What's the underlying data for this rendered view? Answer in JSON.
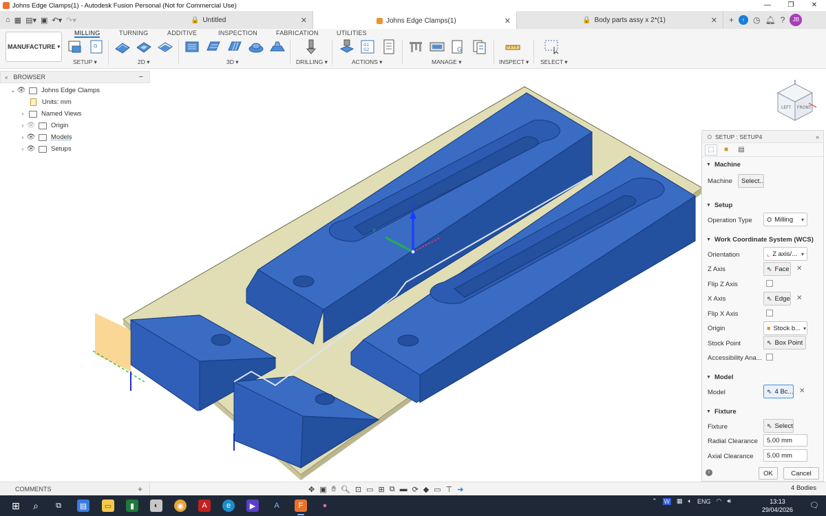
{
  "window": {
    "title": "Johns Edge Clamps(1) - Autodesk Fusion Personal (Not for Commercial Use)",
    "controls": [
      "—",
      "❐",
      "✕"
    ]
  },
  "tabs": [
    {
      "label": "Untitled",
      "icon": "lock-icon"
    },
    {
      "label": "Johns Edge Clamps(1)",
      "icon": "component-icon",
      "active": true
    },
    {
      "label": "Body parts assy x 2*(1)",
      "icon": "lock-icon"
    }
  ],
  "user": {
    "initials": "JB"
  },
  "workspace": {
    "label": "MANUFACTURE"
  },
  "ribbon_tabs": [
    "MILLING",
    "TURNING",
    "ADDITIVE",
    "INSPECTION",
    "FABRICATION",
    "UTILITIES"
  ],
  "ribbon_groups": [
    "SETUP ▾",
    "2D ▾",
    "3D ▾",
    "DRILLING ▾",
    "ACTIONS ▾",
    "MANAGE ▾",
    "INSPECT ▾",
    "SELECT ▾"
  ],
  "browser": {
    "title": "BROWSER",
    "items": [
      {
        "label": "Johns Edge Clamps"
      },
      {
        "label": "Units: mm"
      },
      {
        "label": "Named Views"
      },
      {
        "label": "Origin"
      },
      {
        "label": "Models"
      },
      {
        "label": "Setups"
      }
    ]
  },
  "setup_panel": {
    "title": "SETUP : SETUP4",
    "sections": {
      "machine": "Machine",
      "setup": "Setup",
      "wcs": "Work Coordinate System (WCS)",
      "model": "Model",
      "fixture": "Fixture"
    },
    "fields": {
      "machine_label": "Machine",
      "machine_value": "Select...",
      "operation_type_label": "Operation Type",
      "operation_type_value": "Milling",
      "orientation_label": "Orientation",
      "orientation_value": "Z axis/...",
      "z_axis_label": "Z Axis",
      "z_axis_value": "Face",
      "flip_z_label": "Flip Z Axis",
      "x_axis_label": "X Axis",
      "x_axis_value": "Edge",
      "flip_x_label": "Flip X Axis",
      "origin_label": "Origin",
      "origin_value": "Stock b...",
      "stock_point_label": "Stock Point",
      "stock_point_value": "Box Point",
      "accessibility_label": "Accessibility Ana...",
      "model_label": "Model",
      "model_value": "4 Bc...",
      "fixture_label": "Fixture",
      "fixture_value": "Select",
      "radial_clearance_label": "Radial Clearance",
      "radial_clearance_value": "5.00 mm",
      "axial_clearance_label": "Axial Clearance",
      "axial_clearance_value": "5.00 mm"
    },
    "ok": "OK",
    "cancel": "Cancel"
  },
  "viewcube": {
    "left": "LEFT",
    "front": "FRONT"
  },
  "triad": {
    "y": "Y",
    "z": "Z"
  },
  "bottom": {
    "comments": "COMMENTS",
    "status": "4 Bodies"
  },
  "taskbar": {
    "time": "13:13",
    "date": "29/04/2026",
    "lang": "ENG"
  },
  "colors": {
    "accent": "#1a7fd6",
    "part_blue": "#2f5fb8",
    "stock_tan": "#e2dfb4"
  }
}
